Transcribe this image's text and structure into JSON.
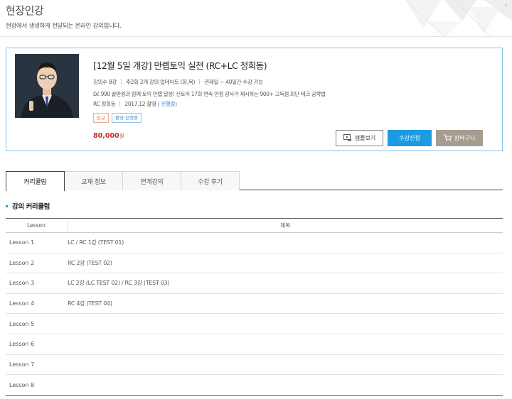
{
  "page": {
    "title": "현장인강",
    "description": "현장에서 생생하게 전달되는 온라인 강의입니다."
  },
  "course": {
    "title": "[12월 5일 개강] 만렙토익 실전 (RC+LC 정희동)",
    "meta": {
      "lectures": "강의수 8강",
      "updates": "주2회 2개 강의 업데이트 (화,목)",
      "period": "권제일 ~ 40일간 수강 가능"
    },
    "description": "LV. 990 끝판왕과 함께 토익 만렙 달성! 신토익 17회 연속 만점 강사가 제시하는 900+ 고득점 최단 테크 공략법",
    "teacher": "RC 정희동",
    "recording": "2017.12 촬영",
    "status": "( 진행중)",
    "badges": {
      "new": "신규",
      "live": "촬영 진행중"
    },
    "price": "80,000",
    "price_unit": "원",
    "buttons": {
      "sample": "샘플보기",
      "apply": "수강신청",
      "cart": "장바구니"
    }
  },
  "tabs": [
    "커리큘럼",
    "교재 정보",
    "연계강의",
    "수강 후기"
  ],
  "curriculum": {
    "title": "강의 커리큘럼",
    "headers": {
      "lesson": "Lesson",
      "subject": "제목"
    },
    "rows": [
      {
        "lesson": "Lesson 1",
        "title": "LC / RC 1강 (TEST 01)"
      },
      {
        "lesson": "Lesson 2",
        "title": "RC 2강 (TEST 02)"
      },
      {
        "lesson": "Lesson 3",
        "title": "LC 2강 (LC TEST 02) / RC 3강 (TEST 03)"
      },
      {
        "lesson": "Lesson 4",
        "title": "RC 4강 (TEST 04)"
      },
      {
        "lesson": "Lesson 5",
        "title": ""
      },
      {
        "lesson": "Lesson 6",
        "title": ""
      },
      {
        "lesson": "Lesson 7",
        "title": ""
      },
      {
        "lesson": "Lesson 8",
        "title": ""
      }
    ]
  },
  "colors": {
    "accent": "#1d9be0",
    "card_border": "#7fc4ea",
    "price": "#c62e2e",
    "cart_button": "#a79d8f"
  }
}
